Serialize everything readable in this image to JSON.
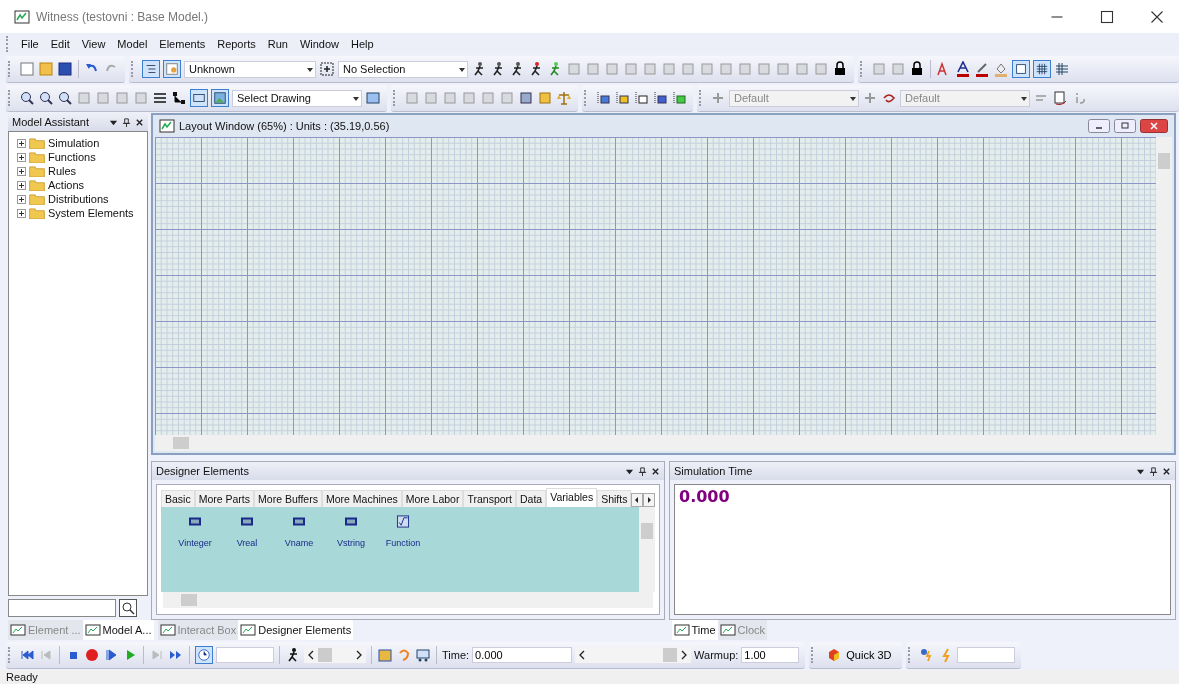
{
  "window": {
    "title": "Witness (testovni : Base Model.)"
  },
  "menu": [
    "File",
    "Edit",
    "View",
    "Model",
    "Elements",
    "Reports",
    "Run",
    "Window",
    "Help"
  ],
  "toolbar_1": {
    "element_type": "Unknown",
    "selection": "No Selection"
  },
  "toolbar_2": {
    "drawing": "Select Drawing",
    "style_1": "Default",
    "style_2": "Default"
  },
  "model_assistant": {
    "title": "Model Assistant",
    "items": [
      {
        "label": "Simulation",
        "expanded": false
      },
      {
        "label": "Functions",
        "expanded": false
      },
      {
        "label": "Rules",
        "expanded": false
      },
      {
        "label": "Actions",
        "expanded": false
      },
      {
        "label": "Distributions",
        "expanded": false
      },
      {
        "label": "System Elements",
        "expanded": false
      }
    ]
  },
  "left_tabs": [
    {
      "label": "Element ...",
      "selected": false
    },
    {
      "label": "Model A...",
      "selected": true
    }
  ],
  "layout_window": {
    "title": "Layout Window (65%)  : Units : (35.19,0.56)"
  },
  "designer_elements": {
    "title": "Designer Elements",
    "tabs": [
      {
        "label": "Basic",
        "selected": false
      },
      {
        "label": "More Parts",
        "selected": false
      },
      {
        "label": "More Buffers",
        "selected": false
      },
      {
        "label": "More Machines",
        "selected": false
      },
      {
        "label": "More Labor",
        "selected": false
      },
      {
        "label": "Transport",
        "selected": false
      },
      {
        "label": "Data",
        "selected": false
      },
      {
        "label": "Variables",
        "selected": true
      },
      {
        "label": "Shifts",
        "selected": false
      }
    ],
    "items": [
      {
        "label": "Vinteger",
        "kind": "variable"
      },
      {
        "label": "Vreal",
        "kind": "variable"
      },
      {
        "label": "Vname",
        "kind": "variable"
      },
      {
        "label": "Vstring",
        "kind": "variable"
      },
      {
        "label": "Function",
        "kind": "function"
      }
    ]
  },
  "center_tabs": [
    {
      "label": "Interact Box",
      "selected": false
    },
    {
      "label": "Designer Elements",
      "selected": true
    }
  ],
  "simulation_time": {
    "title": "Simulation Time",
    "value": "0.000"
  },
  "right_tabs": [
    {
      "label": "Time",
      "selected": true
    },
    {
      "label": "Clock",
      "selected": false
    }
  ],
  "run_toolbar": {
    "time_label": "Time:",
    "time_value": "0.000",
    "warmup_label": "Warmup:",
    "warmup_value": "1.00",
    "quick_3d": "Quick 3D"
  },
  "status_bar": "Ready"
}
